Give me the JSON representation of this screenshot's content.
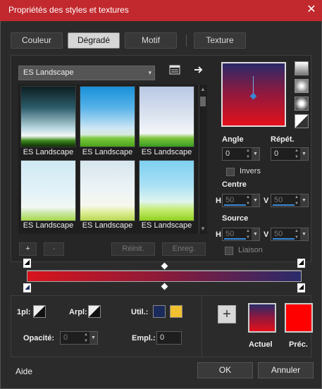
{
  "window": {
    "title": "Propriétés des styles et textures",
    "close_glyph": "✕"
  },
  "tabs": [
    {
      "label": "Couleur",
      "active": false
    },
    {
      "label": "Dégradé",
      "active": true
    },
    {
      "label": "Motif",
      "active": false
    },
    {
      "label": "Texture",
      "active": false
    }
  ],
  "preset": {
    "selected": "ES Landscape",
    "arrow": "▾"
  },
  "gallery": {
    "items": [
      {
        "label": "ES Landscape"
      },
      {
        "label": "ES Landscape"
      },
      {
        "label": "ES Landscape"
      },
      {
        "label": "ES Landscape"
      },
      {
        "label": "ES Landscape"
      },
      {
        "label": "ES Landscape"
      }
    ]
  },
  "gallery_buttons": {
    "add": "+",
    "remove": "-",
    "reset": "Réinit.",
    "save": "Enreg."
  },
  "params": {
    "angle_label": "Angle",
    "angle_value": "0",
    "repeat_label": "Répét.",
    "repeat_value": "0",
    "invert_label": "Invers",
    "center_label": "Centre",
    "center_h_label": "H",
    "center_h_value": "50",
    "center_v_label": "V",
    "center_v_value": "50",
    "source_label": "Source",
    "source_h_label": "H",
    "source_h_value": "50",
    "source_v_label": "V",
    "source_v_value": "50",
    "link_label": "Liaison"
  },
  "bottom": {
    "fg_label": "1pl:",
    "bg_label": "Arpl:",
    "util_label": "Util.:",
    "opacity_label": "Opacité:",
    "opacity_value": "0",
    "location_label": "Empl.:",
    "location_value": "0",
    "current_label": "Actuel",
    "previous_label": "Préc.",
    "add_glyph": "+"
  },
  "colors": {
    "stop_red": "#d8141c",
    "stop_navy": "#1f2a5a",
    "util_navy": "#1a2a5a",
    "util_gold": "#f0c030",
    "title_bar": "#c1292e"
  },
  "footer": {
    "help": "Aide",
    "ok": "OK",
    "cancel": "Annuler"
  }
}
